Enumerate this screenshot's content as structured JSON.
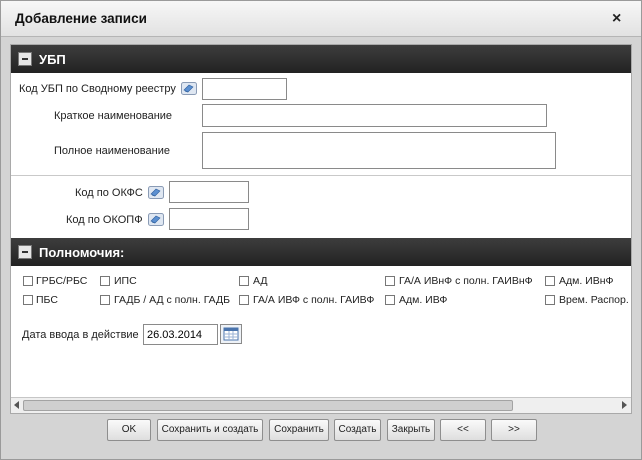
{
  "window": {
    "title": "Добавление записи",
    "close_glyph": "×"
  },
  "ubp": {
    "header": "УБП",
    "code_label": "Код УБП по Сводному реестру",
    "code_value": "",
    "short_label": "Краткое наименование",
    "short_value": "",
    "full_label": "Полное наименование",
    "full_value": ""
  },
  "okfs": {
    "label": "Код по ОКФС",
    "value": ""
  },
  "okopf": {
    "label": "Код по ОКОПФ",
    "value": ""
  },
  "powers": {
    "header": "Полномочия:",
    "items": [
      {
        "label": "ГРБС/РБС",
        "checked": false
      },
      {
        "label": "ИПС",
        "checked": false
      },
      {
        "label": "АД",
        "checked": false
      },
      {
        "label": "ГА/А ИВнФ с полн. ГАИВнФ",
        "checked": false
      },
      {
        "label": "Адм. ИВнФ",
        "checked": false
      },
      {
        "label": "ПБС",
        "checked": false
      },
      {
        "label": "ГАДБ / АД с полн. ГАДБ",
        "checked": false
      },
      {
        "label": "ГА/А ИВФ с полн. ГАИВФ",
        "checked": false
      },
      {
        "label": "Адм. ИВФ",
        "checked": false
      },
      {
        "label": "Врем. Распор.",
        "checked": false
      }
    ]
  },
  "effective_date": {
    "label": "Дата ввода в действие",
    "value": "26.03.2014"
  },
  "buttons": {
    "ok": "OK",
    "save_create": "Сохранить и создать",
    "save": "Сохранить",
    "create": "Создать",
    "close": "Закрыть",
    "prev": "<<",
    "next": ">>"
  },
  "colors": {
    "header_bg": "#2b2b2b",
    "dialog_bg": "#d4d4d4",
    "book_icon": "#5b8fd0"
  }
}
